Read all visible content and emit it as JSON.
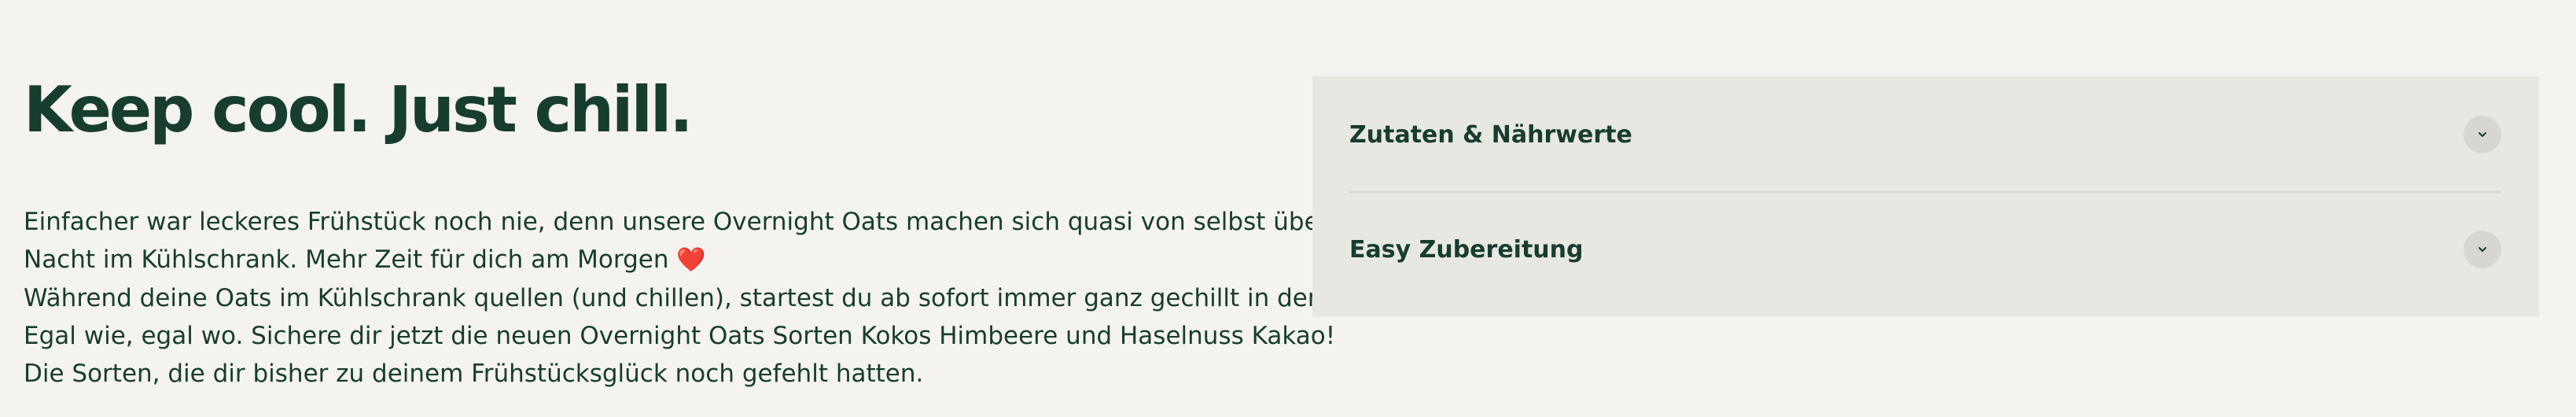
{
  "heading": "Keep cool. Just chill.",
  "description": {
    "lines": [
      "Einfacher war leckeres Frühstück noch nie, denn unsere Overnight Oats machen sich quasi von selbst über",
      "Nacht im Kühlschrank. Mehr Zeit für dich am Morgen",
      "Während deine Oats im Kühlschrank quellen (und chillen), startest du ab sofort immer ganz gechillt in den Tag.",
      "Egal wie, egal wo. Sichere dir jetzt die neuen Overnight Oats Sorten Kokos Himbeere und Haselnuss Kakao!",
      "Die Sorten, die dir bisher zu deinem Frühstücksglück noch gefehlt hatten."
    ],
    "emoji": "❤️"
  },
  "accordion": {
    "items": [
      {
        "label": "Zutaten & Nährwerte",
        "icon": "chevron-down-icon",
        "expanded": false
      },
      {
        "label": "Easy Zubereitung",
        "icon": "chevron-down-icon",
        "expanded": false
      }
    ]
  },
  "colors": {
    "background": "#f4f3ef",
    "text": "#173d2e",
    "panel": "#e8e8e2",
    "chevron_bg": "#d6d7d1",
    "heart": "#d7262f"
  }
}
